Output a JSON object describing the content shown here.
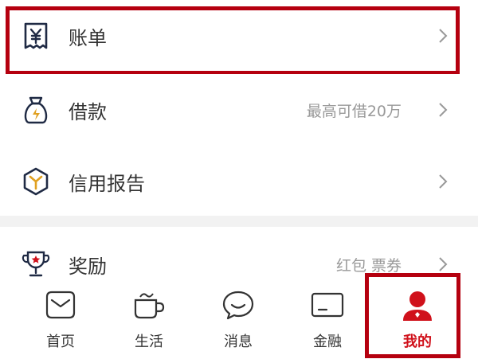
{
  "menu": {
    "bill": {
      "label": "账单",
      "icon": "bill-receipt-icon"
    },
    "loan": {
      "label": "借款",
      "subtext": "最高可借20万",
      "icon": "money-bag-icon"
    },
    "credit": {
      "label": "信用报告",
      "icon": "credit-report-hexagon-icon"
    },
    "rewards": {
      "label": "奖励",
      "subtext": "红包 票券",
      "icon": "trophy-icon"
    }
  },
  "nav": {
    "home": "首页",
    "life": "生活",
    "messages": "消息",
    "finance": "金融",
    "mine": "我的"
  },
  "colors": {
    "accent": "#d0111b",
    "highlight": "#b5000f",
    "icon_dark": "#1f2a44",
    "icon_gold": "#e0a020"
  }
}
